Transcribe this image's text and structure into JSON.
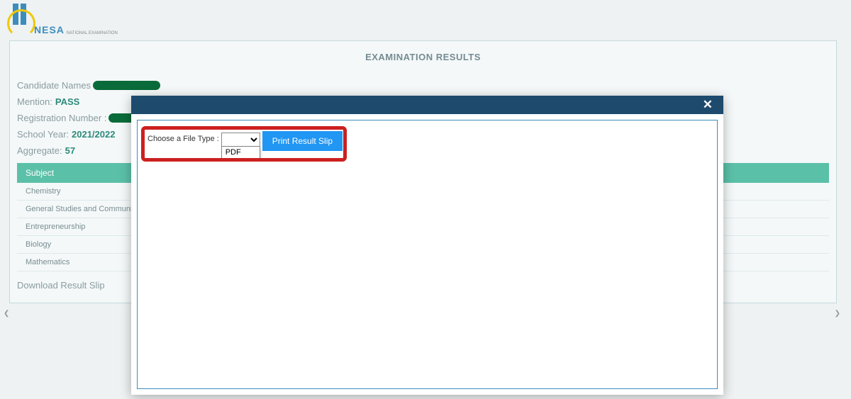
{
  "logo": {
    "brand": "NESA",
    "tagline": "NATIONAL EXAMINATION"
  },
  "panel": {
    "title": "EXAMINATION RESULTS"
  },
  "candidate": {
    "names_label": "Candidate Names",
    "mention_label": "Mention:",
    "mention_value": "PASS",
    "reg_label": "Registration Number :",
    "year_label": "School Year:",
    "year_value": "2021/2022",
    "aggregate_label": "Aggregate:",
    "aggregate_value": "57"
  },
  "table": {
    "header": "Subject",
    "subjects": [
      "Chemistry",
      "General Studies and Communi",
      "Entrepreneurship",
      "Biology",
      "Mathematics"
    ]
  },
  "download_link": "Download Result Slip",
  "modal": {
    "file_type_label": "Choose a File Type :",
    "dropdown_option": "PDF",
    "print_button": "Print Result Slip",
    "close": "✕"
  },
  "scroll": {
    "left": "❮",
    "right": "❯"
  }
}
